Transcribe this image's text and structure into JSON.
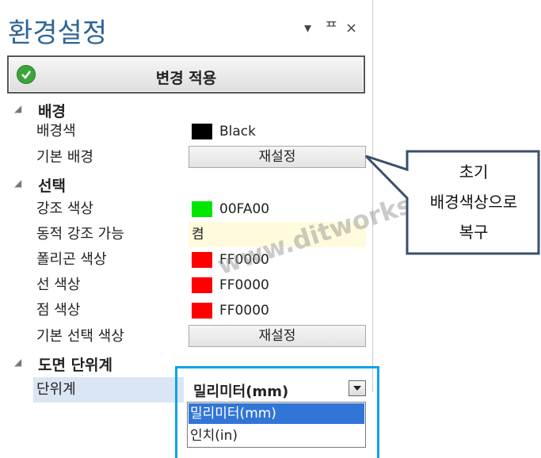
{
  "panel": {
    "title": "환경설정",
    "controls": {
      "dropdown_glyph": "▾",
      "pin_glyph": "ᅟ",
      "pin": "ᄑ",
      "close": "×"
    },
    "apply_button": {
      "label": "변경 적용",
      "icon": "check-circle-icon"
    }
  },
  "categories": [
    {
      "label": "배경",
      "properties": [
        {
          "name": "배경색",
          "value": "Black",
          "color": "#000000"
        },
        {
          "name": "기본 배경",
          "button": "재설정"
        }
      ]
    },
    {
      "label": "선택",
      "properties": [
        {
          "name": "강조 색상",
          "value": "00FA00",
          "color": "#00e600"
        },
        {
          "name": "동적 강조 가능",
          "value": "켬",
          "highlight": "#fffbdc"
        },
        {
          "name": "폴리곤 색상",
          "value": "FF0000",
          "color": "#ff0000"
        },
        {
          "name": "선 색상",
          "value": "FF0000",
          "color": "#ff0000"
        },
        {
          "name": "점 색상",
          "value": "FF0000",
          "color": "#ff0000"
        },
        {
          "name": "기본 선택 색상",
          "button": "재설정"
        }
      ]
    },
    {
      "label": "도면 단위계",
      "properties": [
        {
          "name": "단위계",
          "value": "밀리미터(mm)"
        }
      ]
    }
  ],
  "unit_dropdown": {
    "options": [
      "밀리미터(mm)",
      "인치(in)"
    ],
    "selected_index": 0
  },
  "callout": {
    "lines": [
      "초기",
      "배경색상으로",
      "복구"
    ]
  },
  "watermark": "www.ditworks.com",
  "colors": {
    "title": "#2e6597",
    "highlight_frame": "#0aa5e6",
    "callout_border": "#3a4f6a",
    "selection": "#3175d6"
  }
}
